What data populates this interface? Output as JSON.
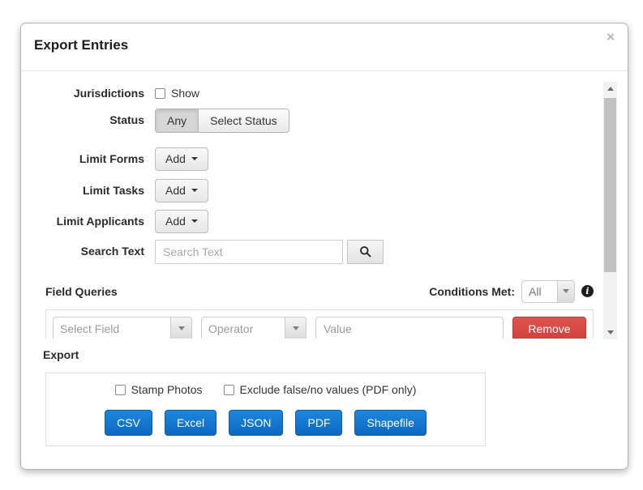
{
  "modal": {
    "title": "Export Entries",
    "close_glyph": "×"
  },
  "rows": {
    "jurisdictions": {
      "label": "Jurisdictions",
      "checkbox_label": "Show",
      "checked": false
    },
    "status": {
      "label": "Status",
      "options": [
        "Any",
        "Select Status"
      ],
      "selected": "Any"
    },
    "limit_forms": {
      "label": "Limit Forms",
      "add_label": "Add"
    },
    "limit_tasks": {
      "label": "Limit Tasks",
      "add_label": "Add"
    },
    "limit_applicants": {
      "label": "Limit Applicants",
      "add_label": "Add"
    },
    "search": {
      "label": "Search Text",
      "placeholder": "Search Text",
      "value": ""
    }
  },
  "field_queries": {
    "title": "Field Queries",
    "conditions_met": {
      "label": "Conditions Met:",
      "value": "All",
      "info_glyph": "i"
    },
    "query_row": {
      "field_placeholder": "Select Field",
      "operator_placeholder": "Operator",
      "value_placeholder": "Value",
      "value": "",
      "remove_label": "Remove"
    }
  },
  "export": {
    "title": "Export",
    "options": [
      {
        "label": "Stamp Photos",
        "checked": false
      },
      {
        "label": "Exclude false/no values (PDF only)",
        "checked": false
      }
    ],
    "format_buttons": [
      "CSV",
      "Excel",
      "JSON",
      "PDF",
      "Shapefile"
    ]
  },
  "colors": {
    "primary_button": "#0d6ec7",
    "danger_button": "#d9534f",
    "active_toggle": "#d6d6d6",
    "scrollbar_thumb": "#c1c1c1"
  }
}
